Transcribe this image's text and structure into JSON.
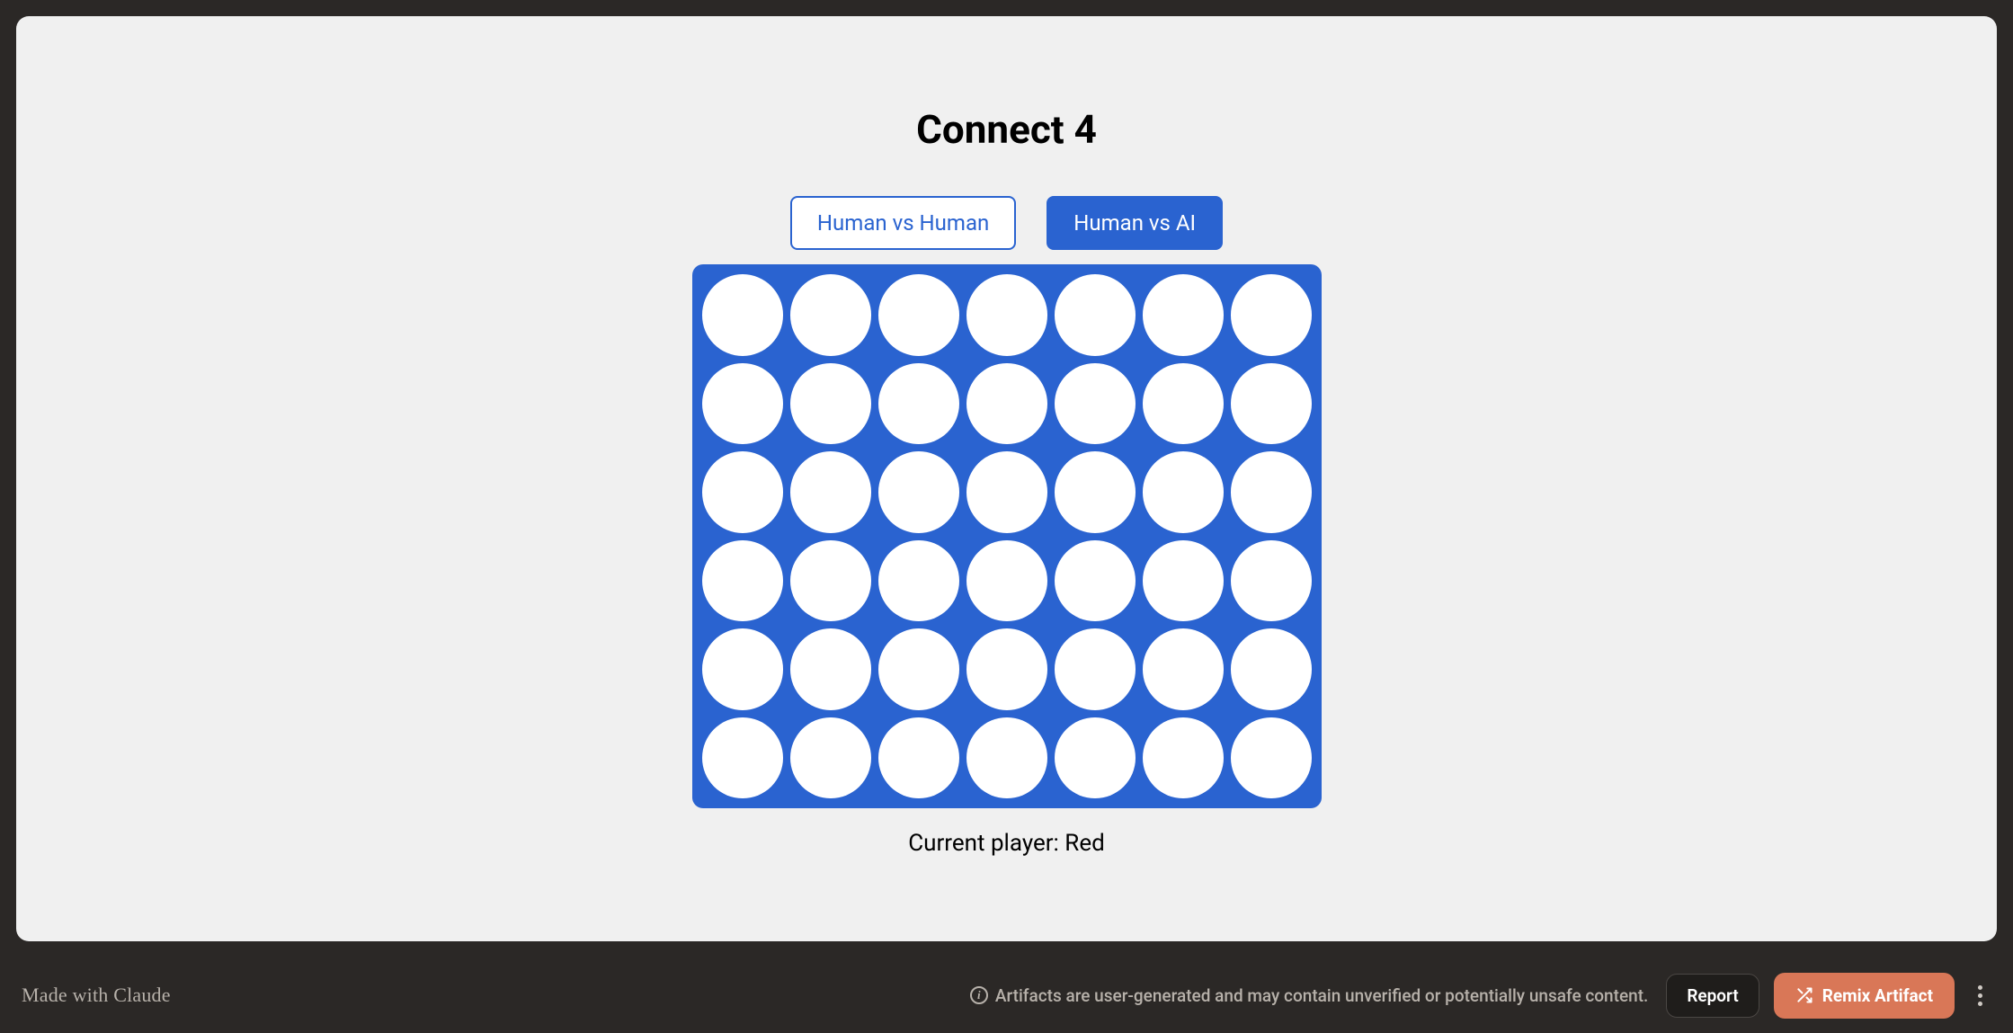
{
  "game": {
    "title": "Connect 4",
    "modes": {
      "human_vs_human": "Human vs Human",
      "human_vs_ai": "Human vs AI",
      "active": "human_vs_ai"
    },
    "board": {
      "rows": 6,
      "cols": 7,
      "cells": [
        [
          "",
          "",
          "",
          "",
          "",
          "",
          ""
        ],
        [
          "",
          "",
          "",
          "",
          "",
          "",
          ""
        ],
        [
          "",
          "",
          "",
          "",
          "",
          "",
          ""
        ],
        [
          "",
          "",
          "",
          "",
          "",
          "",
          ""
        ],
        [
          "",
          "",
          "",
          "",
          "",
          "",
          ""
        ],
        [
          "",
          "",
          "",
          "",
          "",
          "",
          ""
        ]
      ]
    },
    "status_prefix": "Current player: ",
    "current_player": "Red"
  },
  "footer": {
    "made_with_prefix": "Made with ",
    "made_with_brand": "Claude",
    "disclaimer": "Artifacts are user-generated and may contain unverified or potentially unsafe content.",
    "report_label": "Report",
    "remix_label": "Remix Artifact"
  },
  "colors": {
    "board_blue": "#2a63d0",
    "panel_bg": "#f0f0f0",
    "frame_bg": "#2b2826",
    "remix_orange": "#d97757"
  }
}
